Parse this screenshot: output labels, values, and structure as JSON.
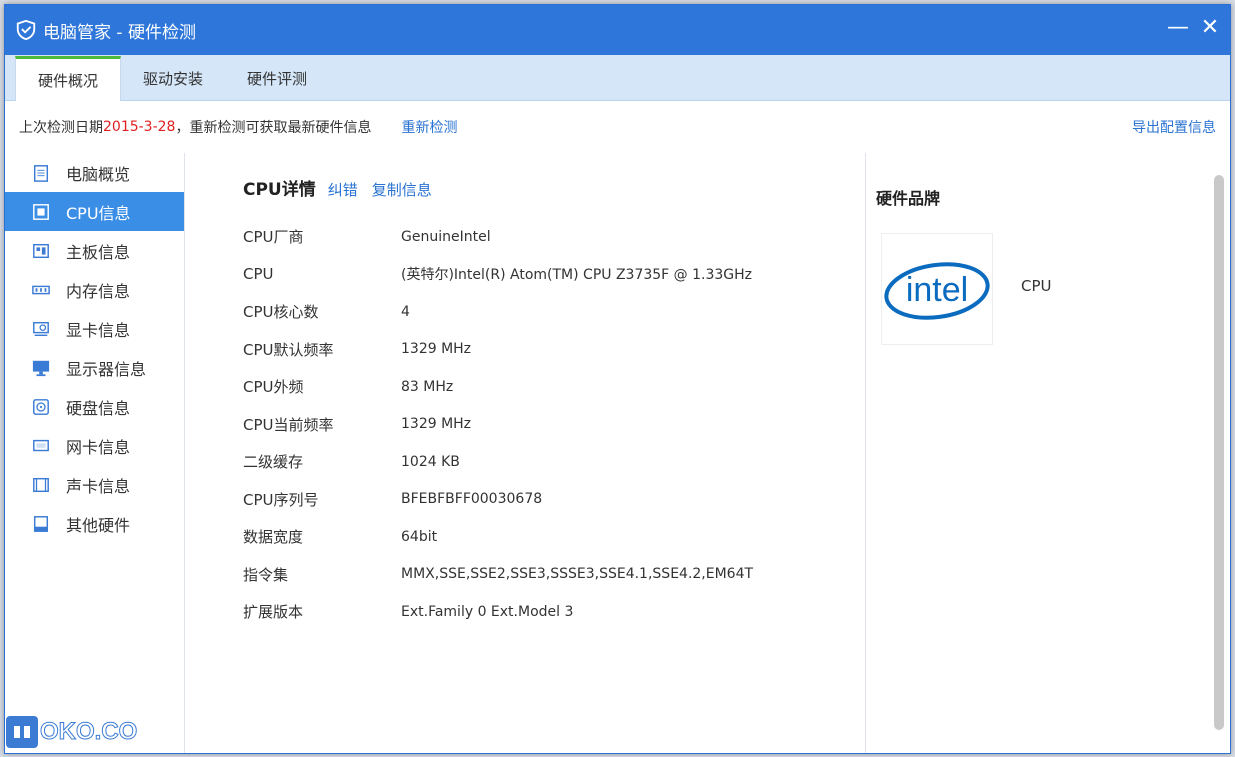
{
  "window": {
    "title": "电脑管家 - 硬件检测",
    "minimize_glyph": "—",
    "close_glyph": "✕"
  },
  "tabs": [
    {
      "label": "硬件概况",
      "active": true
    },
    {
      "label": "驱动安装",
      "active": false
    },
    {
      "label": "硬件评测",
      "active": false
    }
  ],
  "infobar": {
    "prefix": "上次检测日期 ",
    "date": "2015-3-28",
    "suffix": "，重新检测可获取最新硬件信息",
    "recheck": "重新检测",
    "export": "导出配置信息"
  },
  "sidebar": {
    "items": [
      {
        "label": "电脑概览",
        "icon": "clipboard-icon"
      },
      {
        "label": "CPU信息",
        "icon": "cpu-icon",
        "active": true
      },
      {
        "label": "主板信息",
        "icon": "motherboard-icon"
      },
      {
        "label": "内存信息",
        "icon": "memory-icon"
      },
      {
        "label": "显卡信息",
        "icon": "graphics-card-icon"
      },
      {
        "label": "显示器信息",
        "icon": "monitor-icon"
      },
      {
        "label": "硬盘信息",
        "icon": "disk-icon"
      },
      {
        "label": "网卡信息",
        "icon": "network-card-icon"
      },
      {
        "label": "声卡信息",
        "icon": "sound-card-icon"
      },
      {
        "label": "其他硬件",
        "icon": "other-hardware-icon"
      }
    ]
  },
  "detail": {
    "title": "CPU详情",
    "correct": "纠错",
    "copy": "复制信息",
    "rows": [
      {
        "key": "CPU厂商",
        "value": "GenuineIntel"
      },
      {
        "key": "CPU",
        "value": "(英特尔)Intel(R) Atom(TM) CPU  Z3735F @ 1.33GHz"
      },
      {
        "key": "CPU核心数",
        "value": "4"
      },
      {
        "key": "CPU默认频率",
        "value": "1329 MHz"
      },
      {
        "key": "CPU外频",
        "value": "83 MHz"
      },
      {
        "key": "CPU当前频率",
        "value": "1329 MHz"
      },
      {
        "key": "二级缓存",
        "value": "1024 KB"
      },
      {
        "key": "CPU序列号",
        "value": "BFEBFBFF00030678"
      },
      {
        "key": "数据宽度",
        "value": "64bit"
      },
      {
        "key": "指令集",
        "value": "MMX,SSE,SSE2,SSE3,SSSE3,SSE4.1,SSE4.2,EM64T"
      },
      {
        "key": "扩展版本",
        "value": "Ext.Family 0  Ext.Model 3"
      }
    ]
  },
  "brand": {
    "title": "硬件品牌",
    "logo_text": "intel",
    "label": "CPU"
  },
  "watermark": {
    "text": "OKO.CO"
  },
  "colors": {
    "titlebar": "#2e76d9",
    "active_sidebar": "#3b8ee6",
    "link": "#2a73d2",
    "date": "#e02020",
    "tab_accent": "#4cbb3a",
    "intel_blue": "#0a6bbf"
  }
}
